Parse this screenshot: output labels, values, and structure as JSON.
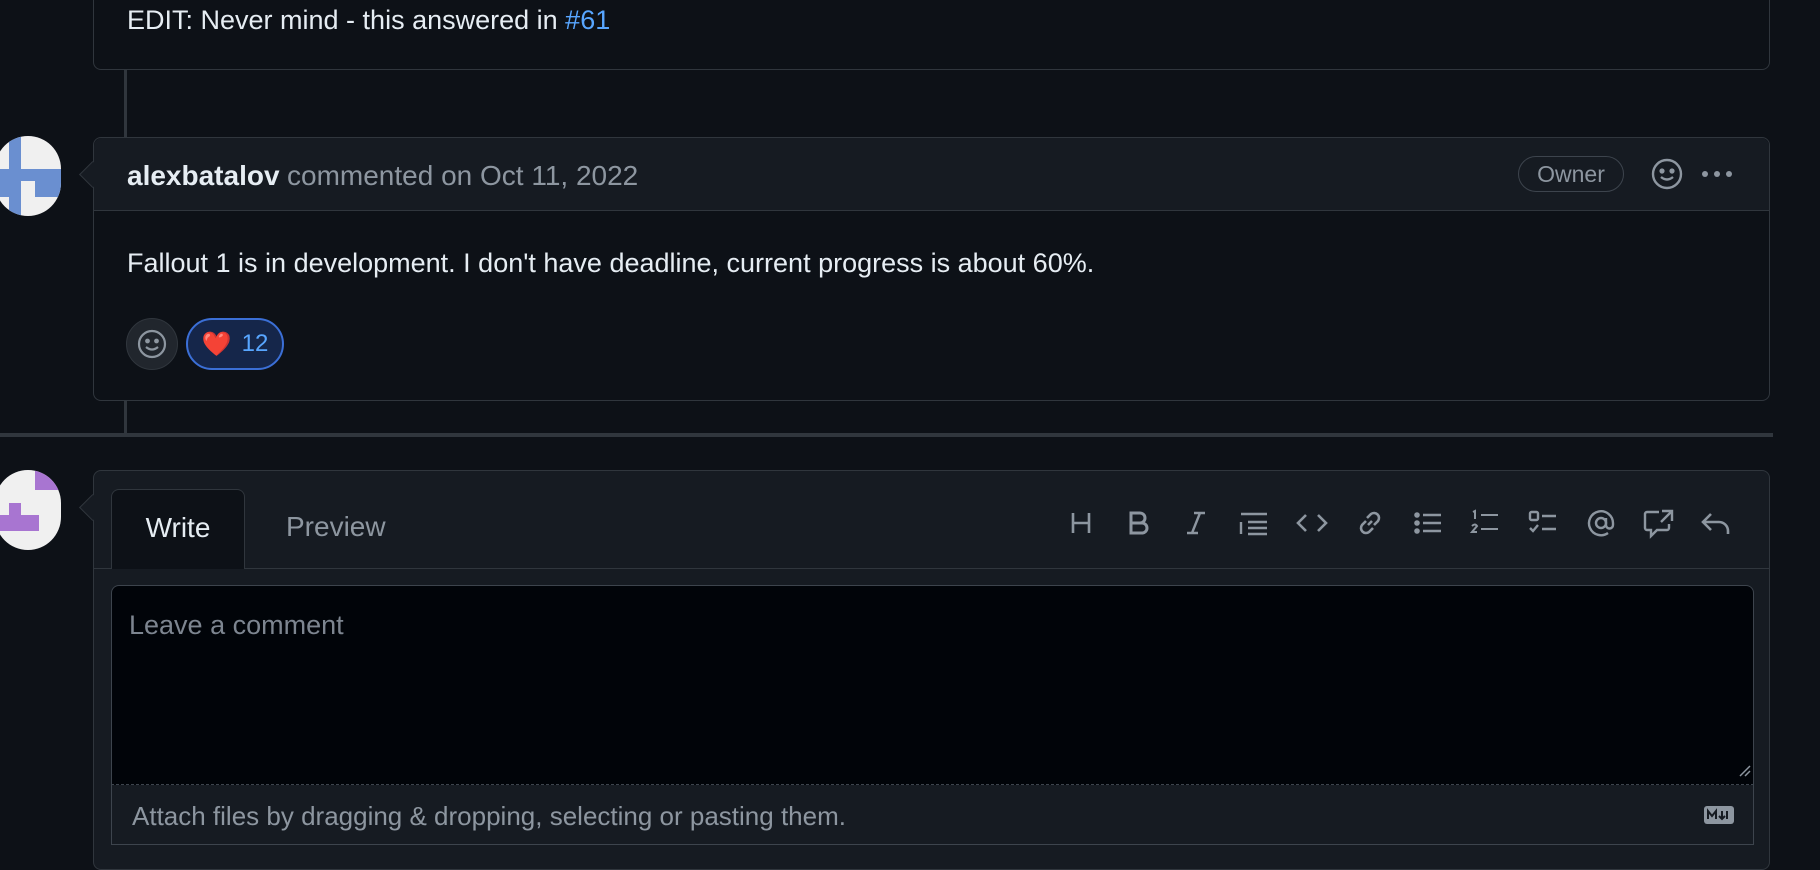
{
  "previous_comment": {
    "text_prefix": "EDIT: Never mind - this answered in ",
    "link": "#61"
  },
  "comment": {
    "author": "alexbatalov",
    "meta": "commented on Oct 11, 2022",
    "role_badge": "Owner",
    "body": "Fallout 1 is in development. I don't have deadline, current progress is about 60%.",
    "reactions": [
      {
        "emoji": "❤️",
        "count": "12"
      }
    ]
  },
  "composer": {
    "tabs": [
      "Write",
      "Preview"
    ],
    "placeholder": "Leave a comment",
    "attach_hint": "Attach files by dragging & dropping, selecting or pasting them.",
    "toolbar": [
      "heading-icon",
      "bold-icon",
      "italic-icon",
      "quote-icon",
      "code-icon",
      "link-icon",
      "bulleted-list-icon",
      "numbered-list-icon",
      "task-list-icon",
      "mention-icon",
      "cross-reference-icon",
      "reply-icon"
    ]
  },
  "colors": {
    "background": "#0d1117",
    "link": "#58a6ff",
    "muted": "#8d96a0",
    "avatar_blue": "#6a8fd0",
    "avatar_purple": "#a875d1"
  }
}
